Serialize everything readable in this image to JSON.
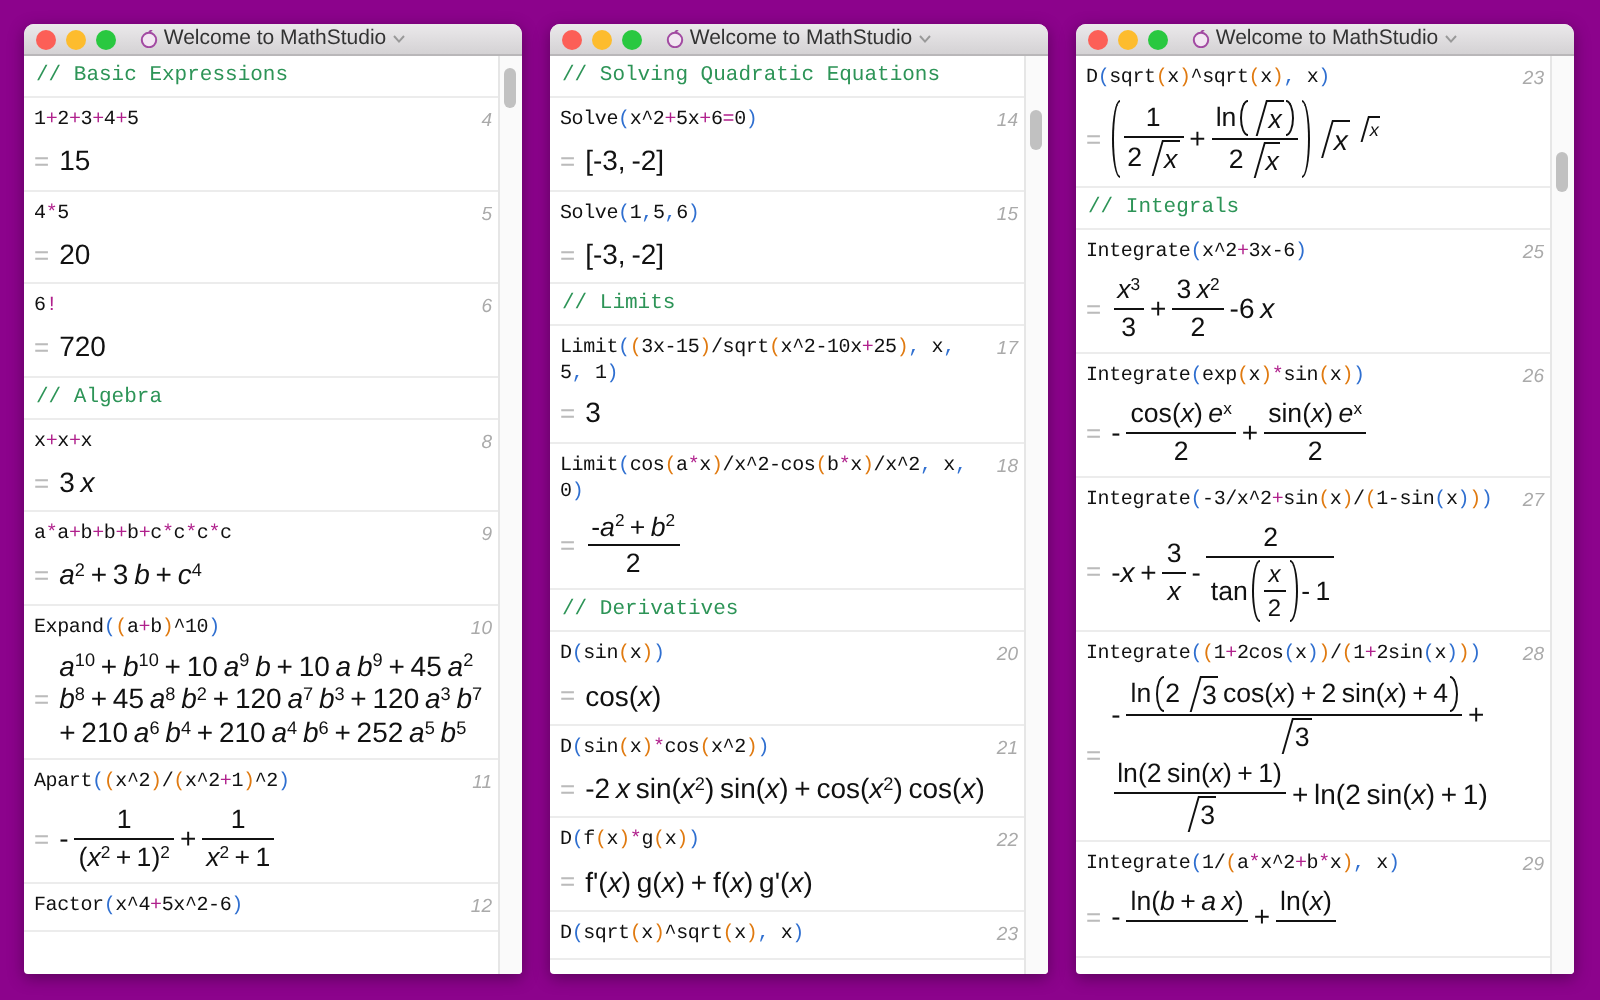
{
  "windows": [
    {
      "title": "Welcome to MathStudio",
      "cells": [
        {
          "kind": "comment",
          "text": "// Basic Expressions"
        },
        {
          "kind": "entry",
          "number": "4",
          "input": "1+2+3+4+5",
          "equals": "=",
          "result": [
            {
              "kind": "text",
              "text": "15"
            }
          ]
        },
        {
          "kind": "entry",
          "number": "5",
          "input": "4*5",
          "equals": "=",
          "result": [
            {
              "kind": "text",
              "text": "20"
            }
          ]
        },
        {
          "kind": "entry",
          "number": "6",
          "input": "6!",
          "equals": "=",
          "result": [
            {
              "kind": "text",
              "text": "720"
            }
          ]
        },
        {
          "kind": "comment",
          "text": "// Algebra"
        },
        {
          "kind": "entry",
          "number": "8",
          "input": "x+x+x",
          "equals": "=",
          "result": [
            {
              "kind": "text",
              "text": "3 *x*"
            }
          ]
        },
        {
          "kind": "entry",
          "number": "9",
          "input": "a*a+b+b+b+c*c*c*c",
          "equals": "=",
          "result": [
            {
              "kind": "text",
              "text": "*a*$^{2}$ + 3 *b* + *c*$^{4}$"
            }
          ]
        },
        {
          "kind": "entry",
          "number": "10",
          "input": "Expand((a+b)^10)",
          "equals": "=",
          "result": [
            {
              "kind": "text",
              "text": "*a*$^{10}$ + *b*$^{10}$ + 10 *a*$^{9}$ *b* + 10 *a* *b*$^{9}$ + 45 *a*$^{2}$ *b*$^{8}$ + 45 *a*$^{8}$ *b*$^{2}$ + 120 *a*$^{7}$ *b*$^{3}$ + 120 *a*$^{3}$ *b*$^{7}$ + 210 *a*$^{6}$ *b*$^{4}$ + 210 *a*$^{4}$ *b*$^{6}$ + 252 *a*$^{5}$ *b*$^{5}$"
            }
          ]
        },
        {
          "kind": "entry",
          "number": "11",
          "input": "Apart((x^2)/(x^2+1)^2)",
          "equals": "=",
          "result": [
            {
              "kind": "text",
              "text": "-"
            },
            {
              "kind": "frac",
              "num": [
                {
                  "kind": "text",
                  "text": "1"
                }
              ],
              "den": [
                {
                  "kind": "text",
                  "text": "(*x*$^{2}$ + 1)$^{2}$"
                }
              ]
            },
            {
              "kind": "text",
              "text": "+"
            },
            {
              "kind": "frac",
              "num": [
                {
                  "kind": "text",
                  "text": "1"
                }
              ],
              "den": [
                {
                  "kind": "text",
                  "text": "*x*$^{2}$ + 1"
                }
              ]
            }
          ]
        },
        {
          "kind": "entry",
          "number": "12",
          "input": "Factor(x^4+5x^2-6)"
        }
      ]
    },
    {
      "title": "Welcome to MathStudio",
      "cells": [
        {
          "kind": "comment",
          "text": "// Solving Quadratic Equations"
        },
        {
          "kind": "entry",
          "number": "14",
          "input": "Solve(x^2+5x+6=0)",
          "equals": "=",
          "result": [
            {
              "kind": "text",
              "text": "[-3, -2]"
            }
          ]
        },
        {
          "kind": "entry",
          "number": "15",
          "input": "Solve(1,5,6)",
          "equals": "=",
          "result": [
            {
              "kind": "text",
              "text": "[-3, -2]"
            }
          ]
        },
        {
          "kind": "comment",
          "text": "// Limits"
        },
        {
          "kind": "entry",
          "number": "17",
          "input": [
            "Limit((3x-15)/sqrt(x^2-10x+25), x,",
            "5, 1)"
          ],
          "equals": "=",
          "result": [
            {
              "kind": "text",
              "text": "3"
            }
          ]
        },
        {
          "kind": "entry",
          "number": "18",
          "input": [
            "Limit(cos(a*x)/x^2-cos(b*x)/x^2, x,",
            "0)"
          ],
          "equals": "=",
          "result": [
            {
              "kind": "frac",
              "num": [
                {
                  "kind": "text",
                  "text": "-*a*$^{2}$ + *b*$^{2}$"
                }
              ],
              "den": [
                {
                  "kind": "text",
                  "text": "2"
                }
              ]
            }
          ]
        },
        {
          "kind": "comment",
          "text": "// Derivatives"
        },
        {
          "kind": "entry",
          "number": "20",
          "input": "D(sin(x))",
          "equals": "=",
          "result": [
            {
              "kind": "text",
              "text": "cos(*x*)"
            }
          ]
        },
        {
          "kind": "entry",
          "number": "21",
          "input": "D(sin(x)*cos(x^2))",
          "equals": "=",
          "result": [
            {
              "kind": "text",
              "text": "-2 *x* sin(*x*$^{2}$) sin(*x*) + cos(*x*$^{2}$) cos(*x*)"
            }
          ]
        },
        {
          "kind": "entry",
          "number": "22",
          "input": "D(f(x)*g(x))",
          "equals": "=",
          "result": [
            {
              "kind": "text",
              "text": "f'(*x*) g(*x*) + f(*x*) g'(*x*)"
            }
          ]
        },
        {
          "kind": "entry",
          "number": "23",
          "input": "D(sqrt(x)^sqrt(x), x)"
        }
      ]
    },
    {
      "title": "Welcome to MathStudio",
      "cells": [
        {
          "kind": "entry",
          "number": "23",
          "input": "D(sqrt(x)^sqrt(x), x)",
          "equals": "=",
          "result": [
            {
              "kind": "paren",
              "body": [
                {
                  "kind": "frac",
                  "num": [
                    {
                      "kind": "text",
                      "text": "1"
                    }
                  ],
                  "den": [
                    {
                      "kind": "text",
                      "text": "2"
                    },
                    {
                      "kind": "sqrt",
                      "body": [
                        {
                          "kind": "text",
                          "text": "*x*"
                        }
                      ]
                    }
                  ]
                },
                {
                  "kind": "text",
                  "text": "+"
                },
                {
                  "kind": "frac",
                  "num": [
                    {
                      "kind": "text",
                      "text": "ln"
                    },
                    {
                      "kind": "paren",
                      "body": [
                        {
                          "kind": "sqrt",
                          "body": [
                            {
                              "kind": "text",
                              "text": "*x*"
                            }
                          ]
                        }
                      ]
                    }
                  ],
                  "den": [
                    {
                      "kind": "text",
                      "text": "2"
                    },
                    {
                      "kind": "sqrt",
                      "body": [
                        {
                          "kind": "text",
                          "text": "*x*"
                        }
                      ]
                    }
                  ]
                }
              ]
            },
            {
              "kind": "pow",
              "base": [
                {
                  "kind": "sqrt",
                  "body": [
                    {
                      "kind": "text",
                      "text": "*x*"
                    }
                  ]
                }
              ],
              "exp": [
                {
                  "kind": "sqrt",
                  "body": [
                    {
                      "kind": "text",
                      "text": "*x*"
                    }
                  ]
                }
              ]
            }
          ]
        },
        {
          "kind": "comment",
          "text": "// Integrals"
        },
        {
          "kind": "entry",
          "number": "25",
          "input": "Integrate(x^2+3x-6)",
          "equals": "=",
          "result": [
            {
              "kind": "frac",
              "num": [
                {
                  "kind": "text",
                  "text": "*x*$^{3}$"
                }
              ],
              "den": [
                {
                  "kind": "text",
                  "text": "3"
                }
              ]
            },
            {
              "kind": "text",
              "text": "+"
            },
            {
              "kind": "frac",
              "num": [
                {
                  "kind": "text",
                  "text": "3 *x*$^{2}$"
                }
              ],
              "den": [
                {
                  "kind": "text",
                  "text": "2"
                }
              ]
            },
            {
              "kind": "text",
              "text": "-6 *x*"
            }
          ]
        },
        {
          "kind": "entry",
          "number": "26",
          "input": "Integrate(exp(x)*sin(x))",
          "equals": "=",
          "result": [
            {
              "kind": "text",
              "text": "-"
            },
            {
              "kind": "frac",
              "num": [
                {
                  "kind": "text",
                  "text": "cos(*x*) *e*$^{x}$"
                }
              ],
              "den": [
                {
                  "kind": "text",
                  "text": "2"
                }
              ]
            },
            {
              "kind": "text",
              "text": "+"
            },
            {
              "kind": "frac",
              "num": [
                {
                  "kind": "text",
                  "text": "sin(*x*) *e*$^{x}$"
                }
              ],
              "den": [
                {
                  "kind": "text",
                  "text": "2"
                }
              ]
            }
          ]
        },
        {
          "kind": "entry",
          "number": "27",
          "input": "Integrate(-3/x^2+sin(x)/(1-sin(x)))",
          "equals": "=",
          "result": [
            {
              "kind": "text",
              "text": "-*x* +"
            },
            {
              "kind": "frac",
              "num": [
                {
                  "kind": "text",
                  "text": "3"
                }
              ],
              "den": [
                {
                  "kind": "text",
                  "text": "*x*"
                }
              ]
            },
            {
              "kind": "text",
              "text": "-"
            },
            {
              "kind": "frac",
              "num": [
                {
                  "kind": "text",
                  "text": "2"
                }
              ],
              "den": [
                {
                  "kind": "text",
                  "text": "tan"
                },
                {
                  "kind": "paren",
                  "body": [
                    {
                      "kind": "frac",
                      "num": [
                        {
                          "kind": "text",
                          "text": "*x*"
                        }
                      ],
                      "den": [
                        {
                          "kind": "text",
                          "text": "2"
                        }
                      ]
                    }
                  ]
                },
                {
                  "kind": "text",
                  "text": "- 1"
                }
              ]
            }
          ]
        },
        {
          "kind": "entry",
          "number": "28",
          "input": "Integrate((1+2cos(x))/(1+2sin(x)))",
          "equals": "=",
          "result": [
            {
              "kind": "text",
              "text": "-"
            },
            {
              "kind": "frac",
              "num": [
                {
                  "kind": "text",
                  "text": "ln"
                },
                {
                  "kind": "paren",
                  "body": [
                    {
                      "kind": "text",
                      "text": "2"
                    },
                    {
                      "kind": "sqrt",
                      "body": [
                        {
                          "kind": "text",
                          "text": "3"
                        }
                      ]
                    },
                    {
                      "kind": "text",
                      "text": "cos(*x*) + 2 sin(*x*) + 4"
                    }
                  ]
                }
              ],
              "den": [
                {
                  "kind": "sqrt",
                  "body": [
                    {
                      "kind": "text",
                      "text": "3"
                    }
                  ]
                }
              ]
            },
            {
              "kind": "text",
              "text": "+"
            },
            {
              "kind": "frac",
              "num": [
                {
                  "kind": "text",
                  "text": "ln(2 sin(*x*) + 1)"
                }
              ],
              "den": [
                {
                  "kind": "sqrt",
                  "body": [
                    {
                      "kind": "text",
                      "text": "3"
                    }
                  ]
                }
              ]
            },
            {
              "kind": "text",
              "text": "+ ln(2 sin(*x*) + 1)"
            }
          ]
        },
        {
          "kind": "entry",
          "number": "29",
          "input": "Integrate(1/(a*x^2+b*x), x)",
          "equals": "=",
          "result": [
            {
              "kind": "text",
              "text": "-"
            },
            {
              "kind": "frac",
              "num": [
                {
                  "kind": "text",
                  "text": "ln(*b* + *a* *x*)"
                }
              ]
            },
            {
              "kind": "text",
              "text": "+"
            },
            {
              "kind": "frac",
              "num": [
                {
                  "kind": "text",
                  "text": "ln(*x*)"
                }
              ]
            }
          ]
        }
      ]
    }
  ]
}
